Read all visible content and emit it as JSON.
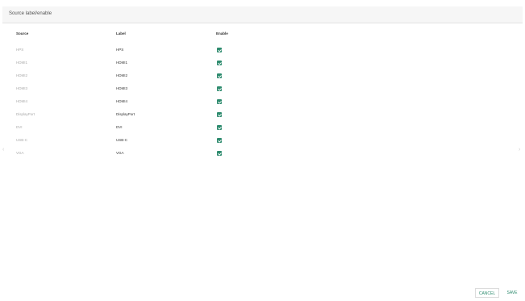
{
  "dialog": {
    "title": "Source label/enable"
  },
  "table": {
    "headers": {
      "source": "Source",
      "label": "Label",
      "enable": "Enable"
    },
    "rows": [
      {
        "source": "HPS",
        "label": "HPS",
        "enabled": true
      },
      {
        "source": "HDMI1",
        "label": "HDMI1",
        "enabled": true
      },
      {
        "source": "HDMI2",
        "label": "HDMI2",
        "enabled": true
      },
      {
        "source": "HDMI3",
        "label": "HDMI3",
        "enabled": true
      },
      {
        "source": "HDMI4",
        "label": "HDMI4",
        "enabled": true
      },
      {
        "source": "DisplayPort",
        "label": "DisplayPort",
        "enabled": true
      },
      {
        "source": "DVI",
        "label": "DVI",
        "enabled": true
      },
      {
        "source": "USB-C",
        "label": "USB-C",
        "enabled": true
      },
      {
        "source": "VGA",
        "label": "VGA",
        "enabled": true
      }
    ]
  },
  "navigation": {
    "left_arrow": "‹",
    "right_arrow": "›"
  },
  "actions": {
    "cancel_label": "CANCEL",
    "save_label": "SAVE"
  },
  "colors": {
    "accent": "#2e8b6e",
    "titlebar_background": "#f6f6f6",
    "muted_text": "#aaaaaa",
    "primary_text": "#333333"
  }
}
